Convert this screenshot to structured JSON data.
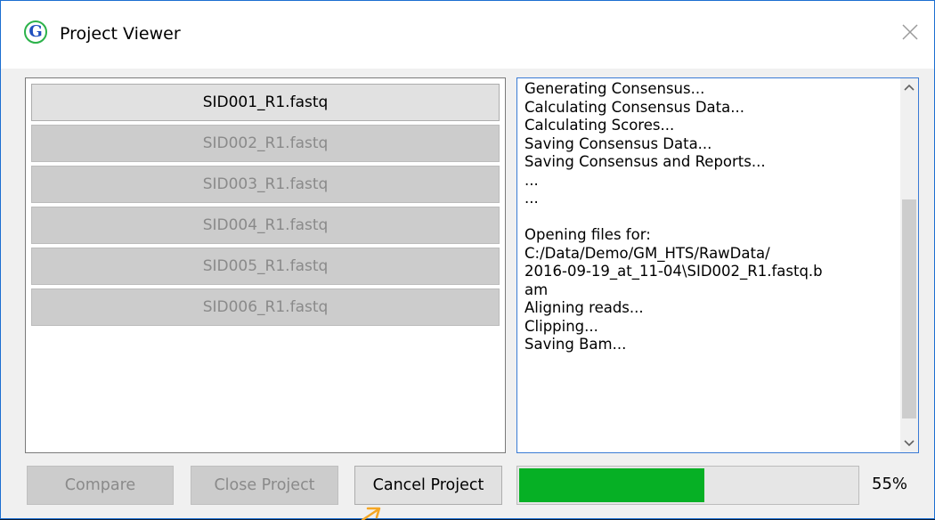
{
  "window": {
    "title": "Project Viewer",
    "icon_letter": "G"
  },
  "files": [
    {
      "label": "SID001_R1.fastq",
      "active": true
    },
    {
      "label": "SID002_R1.fastq",
      "active": false
    },
    {
      "label": "SID003_R1.fastq",
      "active": false
    },
    {
      "label": "SID004_R1.fastq",
      "active": false
    },
    {
      "label": "SID005_R1.fastq",
      "active": false
    },
    {
      "label": "SID006_R1.fastq",
      "active": false
    }
  ],
  "log": {
    "text": "Generating Consensus...\nCalculating Consensus Data...\nCalculating Scores...\nSaving Consensus Data...\nSaving Consensus and Reports...\n...\n...\n\nOpening files for:\nC:/Data/Demo/GM_HTS/RawData/\n2016-09-19_at_11-04\\SID002_R1.fastq.b\nam\nAligning reads...\nClipping...\nSaving Bam..."
  },
  "buttons": {
    "compare": "Compare",
    "close_project": "Close Project",
    "cancel_project": "Cancel Project"
  },
  "progress": {
    "value": 55,
    "label": "55%"
  },
  "colors": {
    "progress_fill": "#06b025",
    "pointer": "#f5a623",
    "window_border": "#1c6fd1"
  },
  "icons": {
    "app": "geneious-g-icon",
    "close": "close-icon",
    "scroll_up": "chevron-up-icon",
    "scroll_down": "chevron-down-icon",
    "pointer": "arrow-pointer-icon"
  }
}
